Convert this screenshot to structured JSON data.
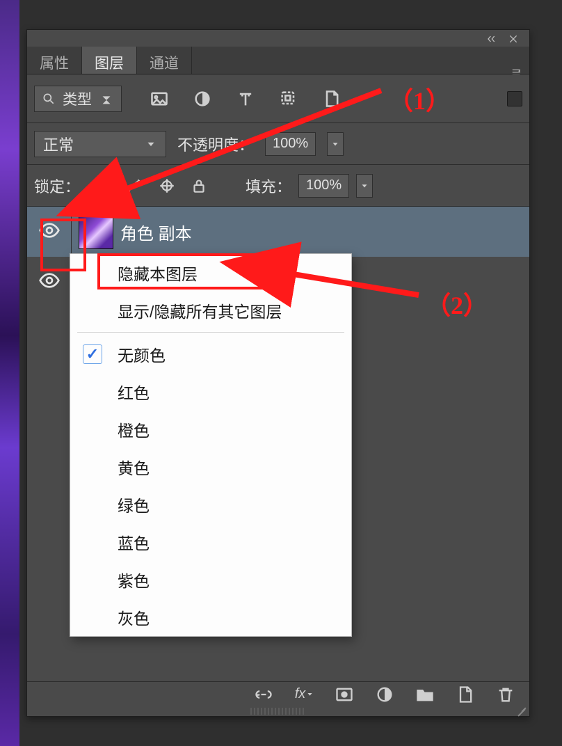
{
  "tabs": {
    "properties": "属性",
    "layers": "图层",
    "channels": "通道",
    "active": "layers"
  },
  "filter": {
    "type_label": "类型"
  },
  "blend": {
    "mode": "正常",
    "opacity_label": "不透明度：",
    "opacity_value": "100%"
  },
  "lock": {
    "label": "锁定：",
    "fill_label": "填充：",
    "fill_value": "100%"
  },
  "layers_list": [
    {
      "name": "角色 副本",
      "visible": true,
      "selected": true
    },
    {
      "name": "",
      "visible": true,
      "selected": false
    }
  ],
  "context_menu": {
    "hide_this_layer": "隐藏本图层",
    "show_hide_others": "显示/隐藏所有其它图层",
    "no_color": "无颜色",
    "red": "红色",
    "orange": "橙色",
    "yellow": "黄色",
    "green": "绿色",
    "blue": "蓝色",
    "purple": "紫色",
    "gray": "灰色",
    "selected_color": "no_color"
  },
  "annotations": {
    "one": "（1）",
    "two": "（2）"
  }
}
